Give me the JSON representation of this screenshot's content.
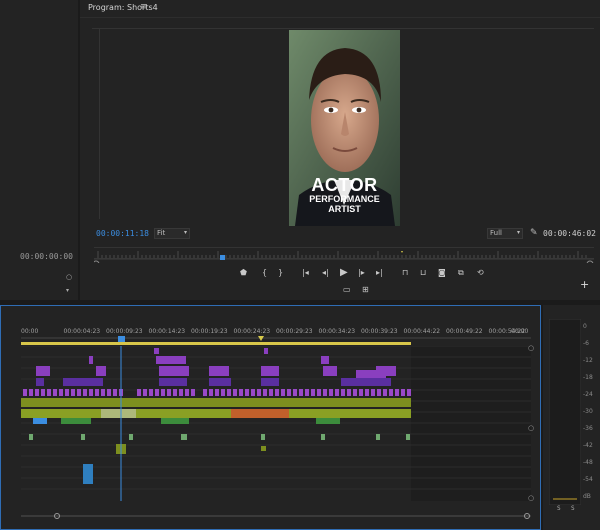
{
  "program": {
    "title": "Program: Shorts4",
    "current_timecode": "00:00:11:18",
    "duration_timecode": "00:00:46:02",
    "zoom_value": "Fit",
    "quality_value": "Full",
    "overlay_line1": "ACTOR",
    "overlay_line2": "PERFORMANCE",
    "overlay_line3": "ARTIST",
    "playhead_fraction": 0.255
  },
  "source": {
    "timecode": "00:00:00:00"
  },
  "timeline": {
    "ticks": [
      "00:00",
      "00:00:04:23",
      "00:00:09:23",
      "00:00:14:23",
      "00:00:19:23",
      "00:00:24:23",
      "00:00:29:23",
      "00:00:34:23",
      "00:00:39:23",
      "00:00:44:22",
      "00:00:49:22",
      "00:00:54:22",
      "00:00"
    ]
  },
  "meter": {
    "ticks": [
      "0",
      "-6",
      "-12",
      "-18",
      "-24",
      "-30",
      "-36",
      "-42",
      "-48",
      "-54",
      "dB"
    ],
    "solo_labels": [
      "S",
      "S"
    ]
  },
  "colors": {
    "accent_blue": "#3b8de0",
    "clip_purple": "#8a3fbf",
    "clip_olive": "#7d8f1f",
    "clip_orange": "#c0602b",
    "clip_green": "#3c8c3c"
  }
}
